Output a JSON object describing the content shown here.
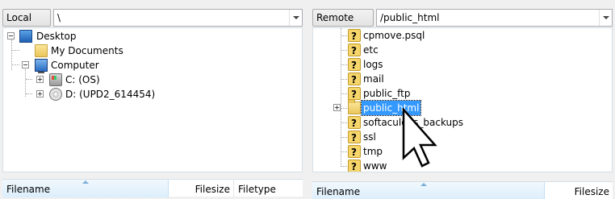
{
  "local": {
    "label": "Local site:",
    "path": "\\",
    "tree": {
      "desktop": "Desktop",
      "my_documents": "My Documents",
      "computer": "Computer",
      "drive_c": "C: (OS)",
      "drive_d": "D: (UPD2_614454)"
    },
    "columns": {
      "filename": "Filename",
      "filesize": "Filesize",
      "filetype": "Filetype"
    }
  },
  "remote": {
    "label": "Remote site:",
    "path": "/public_html",
    "items": [
      {
        "name": "cpmove.psql",
        "icon": "unknown-icon"
      },
      {
        "name": "etc",
        "icon": "unknown-icon"
      },
      {
        "name": "logs",
        "icon": "unknown-icon"
      },
      {
        "name": "mail",
        "icon": "unknown-icon"
      },
      {
        "name": "public_ftp",
        "icon": "unknown-icon"
      },
      {
        "name": "public_html",
        "icon": "folder-icon",
        "selected": true
      },
      {
        "name": "softaculous_backups",
        "icon": "unknown-icon"
      },
      {
        "name": "ssl",
        "icon": "unknown-icon"
      },
      {
        "name": "tmp",
        "icon": "unknown-icon"
      },
      {
        "name": "www",
        "icon": "unknown-icon"
      }
    ],
    "columns": {
      "filename": "Filename",
      "filesize": "Filesize"
    }
  },
  "colors": {
    "selection": "#3399ff",
    "header_active": "#dbeefb"
  }
}
